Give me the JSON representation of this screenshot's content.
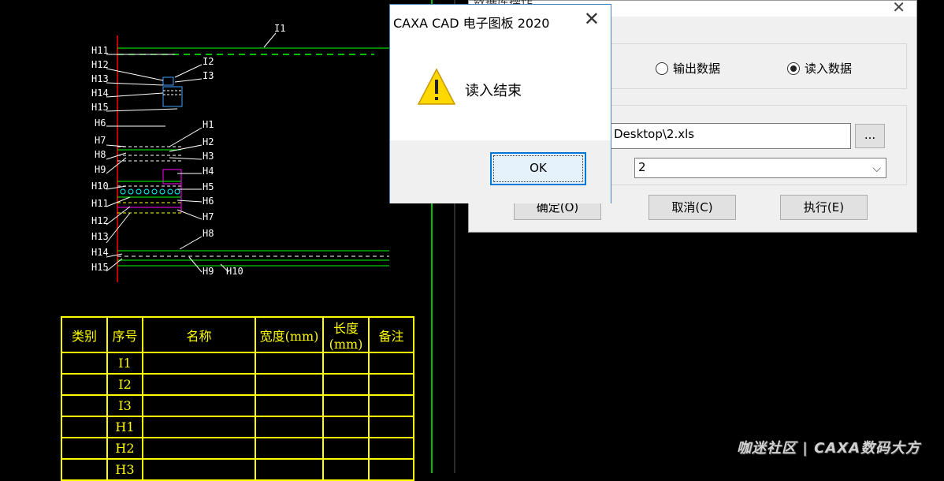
{
  "drawing": {
    "labels_left": [
      "H11",
      "H12",
      "H13",
      "H14",
      "H15",
      "H6",
      "H7",
      "H8",
      "H9",
      "H10",
      "H11",
      "H12",
      "H13",
      "H14",
      "H15"
    ],
    "labels_right": [
      "I1",
      "I2",
      "I3",
      "H1",
      "H2",
      "H3",
      "H4",
      "H5",
      "H6",
      "H7",
      "H8",
      "H9",
      "H10"
    ]
  },
  "table": {
    "headers": [
      "类别",
      "序号",
      "名称",
      "宽度(mm)",
      "长度(mm)",
      "备注"
    ],
    "rows": [
      "I1",
      "I2",
      "I3",
      "H1",
      "H2",
      "H3"
    ]
  },
  "data_dialog": {
    "title": "数据库操作",
    "radio_output": "输出数据",
    "radio_input": "读入数据",
    "file_path": "Desktop\\2.xls",
    "browse_label": "...",
    "sheet_value": "2",
    "ok_label": "确定(O)",
    "cancel_label": "取消(C)",
    "execute_label": "执行(E)"
  },
  "msgbox": {
    "title": "CAXA CAD 电子图板 2020",
    "message": "读入结束",
    "ok_label": "OK"
  },
  "watermark": "咖迷社区 | CAXA数码大方",
  "colors": {
    "line_green": "#00ff00",
    "axis_red": "#ff0000",
    "table_yellow": "#ffff00"
  }
}
